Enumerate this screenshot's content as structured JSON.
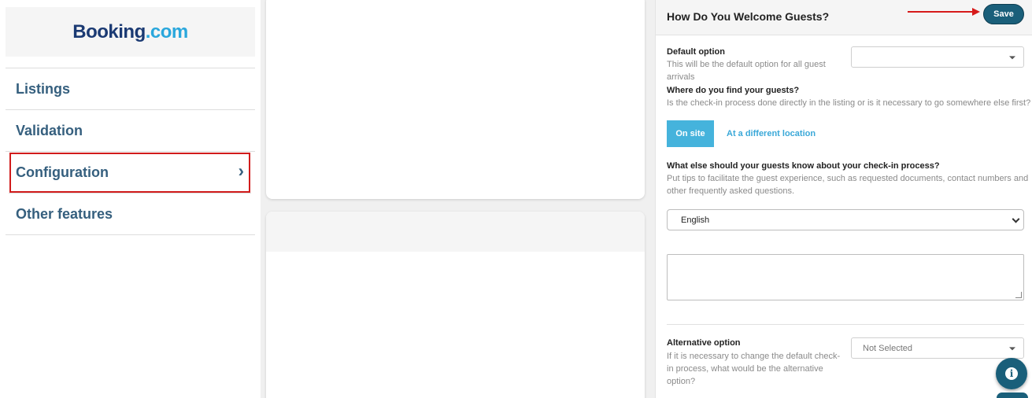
{
  "brand": {
    "part1": "Booking",
    "part2": ".com"
  },
  "sidebar": {
    "items": [
      {
        "label": "Listings"
      },
      {
        "label": "Validation"
      },
      {
        "label": "Configuration",
        "chevron": "›"
      },
      {
        "label": "Other features"
      }
    ]
  },
  "panel": {
    "title": "How Do You Welcome Guests?",
    "save_label": "Save",
    "default_option": {
      "label": "Default option",
      "hint": "This will be the default option for all guest arrivals",
      "value": ""
    },
    "find_guests": {
      "label": "Where do you find your guests?",
      "hint": "Is the check-in process done directly in the listing or is it necessary to go somewhere else first?",
      "option_on_site": "On site",
      "option_different": "At a different location"
    },
    "else_know": {
      "label": "What else should your guests know about your check-in process?",
      "hint": "Put tips to facilitate the guest experience, such as requested documents, contact numbers and other frequently asked questions."
    },
    "language": {
      "value": "English"
    },
    "tips_text": "",
    "alternative": {
      "label": "Alternative option",
      "hint": "If it is necessary to change the default check-in process, what would be the alternative option?",
      "value": "Not Selected"
    }
  },
  "icons": {
    "info": "info-icon",
    "chevron": "chevron-right-icon",
    "arrow": "annotation-arrow"
  },
  "colors": {
    "brand_dark": "#1b3a73",
    "brand_light": "#2aa7dc",
    "nav_text": "#355f7e",
    "save_button": "#1a5f7a",
    "on_site_button": "#45b3dc",
    "highlight": "#d11c1c"
  }
}
